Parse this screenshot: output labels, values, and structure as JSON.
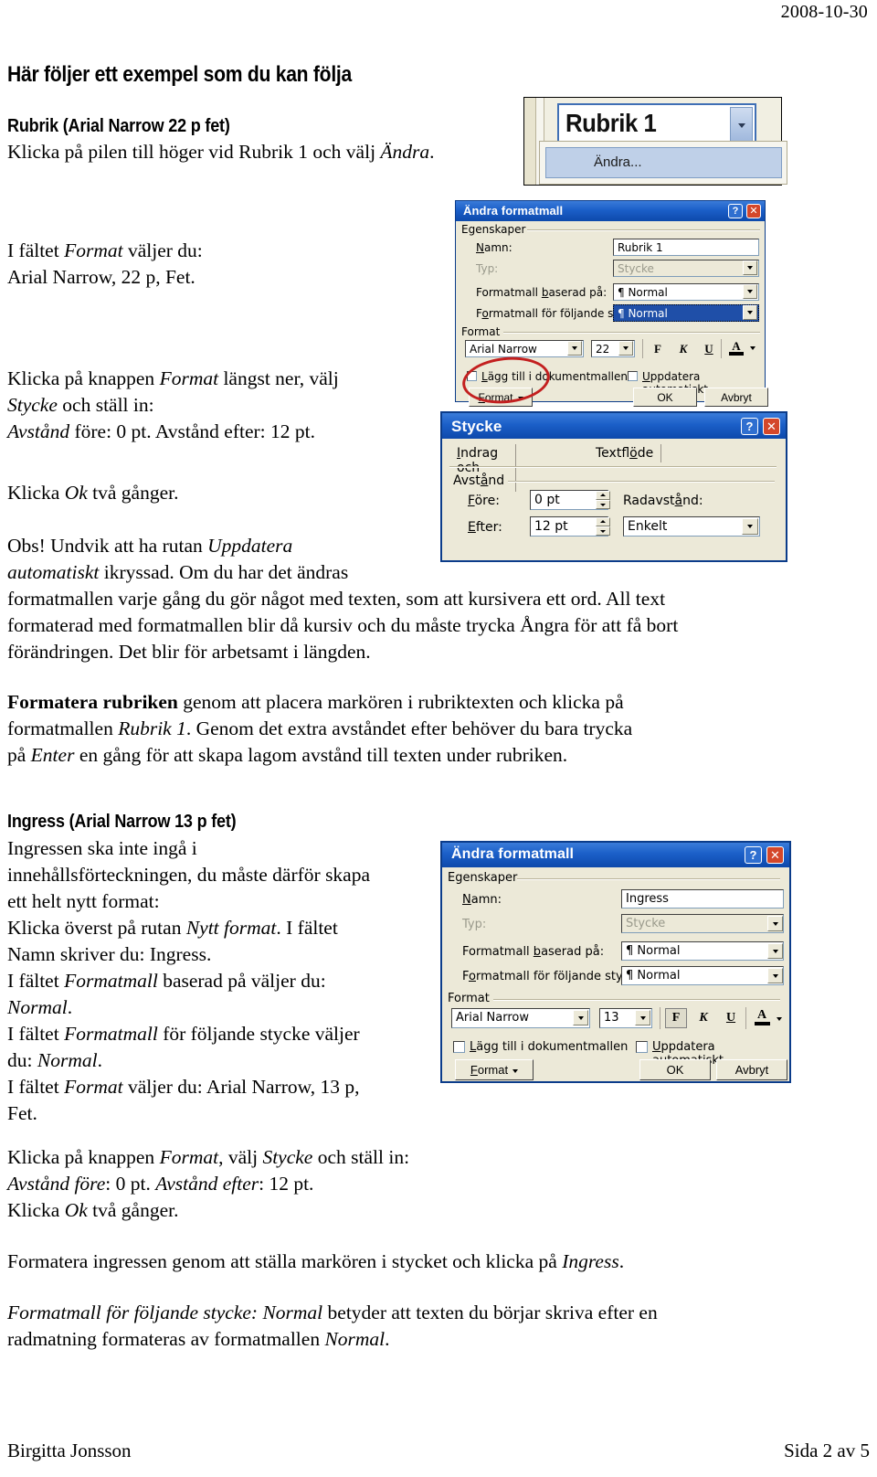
{
  "document": {
    "date": "2008-10-30",
    "heading": "Här följer ett exempel som du kan följa",
    "section1": {
      "heading": "Rubrik (Arial Narrow 22 p fet)",
      "line1": "Klicka på pilen till höger vid Rubrik 1 och välj Ändra.",
      "line1_italic": "Ändra"
    },
    "para_format_field": {
      "l1_pre": "I fältet ",
      "l1_it": "Format",
      "l1_post": " väljer du:",
      "l2": "Arial Narrow, 22 p, Fet."
    },
    "para_format_button": {
      "l1_pre": "Klicka på knappen ",
      "l1_it": "Format",
      "l1_post": " längst ner, välj",
      "l2_it": "Stycke",
      "l2_post": " och ställ in:",
      "l3_it": "Avstånd",
      "l3_post": " före: 0 pt. Avstånd efter: 12 pt."
    },
    "para_ok": {
      "pre": "Klicka ",
      "it": "Ok",
      "post": " två gånger."
    },
    "para_obs": {
      "p1": "Obs! Undvik att ha rutan ",
      "p1_it": "Uppdatera",
      "p2_it": "automatiskt",
      "p2": " ikryssad. Om du har det ändras",
      "p3": "formatmallen varje gång du gör något med texten, som att kursivera ett ord. All text",
      "p4": "formaterad med formatmallen blir då kursiv och du måste trycka Ångra för att få bort",
      "p5": "förändringen. Det blir för arbetsamt i längden."
    },
    "para_formatera_rubriken": {
      "bold": "Formatera rubriken",
      "l1_rest": " genom att placera markören i rubriktexten och klicka på",
      "l2_pre": "formatmallen ",
      "l2_it": "Rubrik 1",
      "l2_post": ". Genom det extra avståndet efter behöver du bara trycka",
      "l3_pre": "på ",
      "l3_it": "Enter",
      "l3_post": " en gång för att skapa lagom avstånd till texten under rubriken."
    },
    "section2": {
      "heading": "Ingress (Arial Narrow 13 p fet)",
      "l1": "Ingressen ska inte ingå i",
      "l2": "innehållsförteckningen, du måste därför skapa",
      "l3": "ett helt nytt format:",
      "l4_pre": "Klicka överst på rutan ",
      "l4_it": "Nytt format",
      "l4_post": ". I fältet",
      "l5": "Namn skriver du: Ingress.",
      "l6_pre": "I fältet ",
      "l6_it": "Formatmall",
      "l6_post": " baserad på väljer du:",
      "l7_it": "Normal",
      "l7_post": ".",
      "l8_pre": "I fältet ",
      "l8_it": "Formatmall",
      "l8_post": " för följande stycke väljer",
      "l9_pre": "du: ",
      "l9_it": "Normal",
      "l9_post": ".",
      "l10_pre": "I fältet ",
      "l10_it": "Format",
      "l10_post": " väljer du: Arial Narrow, 13 p,",
      "l11": "Fet."
    },
    "para_bottom_format": {
      "l1_pre": "Klicka på knappen ",
      "l1_it1": "Format",
      "l1_mid": ", välj ",
      "l1_it2": "Stycke",
      "l1_post": " och ställ in:",
      "l2_it1": "Avstånd före",
      "l2_mid": ": 0 pt. ",
      "l2_it2": "Avstånd efter",
      "l2_post": ": 12 pt.",
      "l3_pre": "Klicka ",
      "l3_it": "Ok",
      "l3_post": " två gånger."
    },
    "para_formatera_ingressen": {
      "pre": "Formatera ingressen genom att ställa markören i stycket och klicka på ",
      "it": "Ingress",
      "post": "."
    },
    "para_final": {
      "l1_it": "Formatmall för följande stycke: Normal",
      "l1_post": " betyder att texten du börjar skriva efter en",
      "l2_pre": "radmatning formateras av formatmallen ",
      "l2_it": "Normal",
      "l2_post": "."
    },
    "footer": {
      "author": "Birgitta Jonsson",
      "page": "Sida 2 av 5"
    }
  },
  "screenshot_style_gallery": {
    "selected_style": "Rubrik 1",
    "menu_item": "Ändra..."
  },
  "dialog_andra_formatmall_1": {
    "title": "Ändra formatmall",
    "help_btn": "?",
    "close_btn": "✕",
    "group_egenskaper": "Egenskaper",
    "label_namn": "Namn:",
    "value_namn": "Rubrik 1",
    "label_typ": "Typ:",
    "value_typ": "Stycke",
    "label_baserad": "Formatmall baserad på:",
    "value_baserad": "¶ Normal",
    "label_foljande": "Formatmall för följande stycke:",
    "value_foljande": "¶ Normal",
    "group_format": "Format",
    "value_font": "Arial Narrow",
    "value_size": "22",
    "btn_bold": "F",
    "btn_italic": "K",
    "btn_underline": "U",
    "btn_fontcolor": "A",
    "chk_lagg_till": "Lägg till i dokumentmallen",
    "chk_uppdatera": "Uppdatera automatiskt",
    "btn_format": "Format",
    "btn_ok": "OK",
    "btn_avbryt": "Avbryt"
  },
  "dialog_stycke": {
    "title": "Stycke",
    "help_btn": "?",
    "close_btn": "✕",
    "tab1": "Indrag och avstånd",
    "tab2": "Textflöde",
    "group_avstand": "Avstånd",
    "label_fore": "Före:",
    "value_fore": "0 pt",
    "label_efter": "Efter:",
    "value_efter": "12 pt",
    "label_radavstand": "Radavstånd:",
    "value_radavstand": "Enkelt"
  },
  "dialog_andra_formatmall_2": {
    "title": "Ändra formatmall",
    "help_btn": "?",
    "close_btn": "✕",
    "group_egenskaper": "Egenskaper",
    "label_namn": "Namn:",
    "value_namn": "Ingress",
    "label_typ": "Typ:",
    "value_typ": "Stycke",
    "label_baserad": "Formatmall baserad på:",
    "value_baserad": "¶ Normal",
    "label_foljande": "Formatmall för följande stycke:",
    "value_foljande": "¶ Normal",
    "group_format": "Format",
    "value_font": "Arial Narrow",
    "value_size": "13",
    "btn_bold": "F",
    "btn_italic": "K",
    "btn_underline": "U",
    "btn_fontcolor": "A",
    "chk_lagg_till": "Lägg till i dokumentmallen",
    "chk_uppdatera": "Uppdatera automatiskt",
    "btn_format": "Format",
    "btn_ok": "OK",
    "btn_avbryt": "Avbryt"
  },
  "colors": {
    "titlebar_blue": "#1b5fc8",
    "dialog_face": "#ece9d8",
    "selection_blue": "#1f4fa8",
    "annotation_red": "#c31f1f"
  }
}
